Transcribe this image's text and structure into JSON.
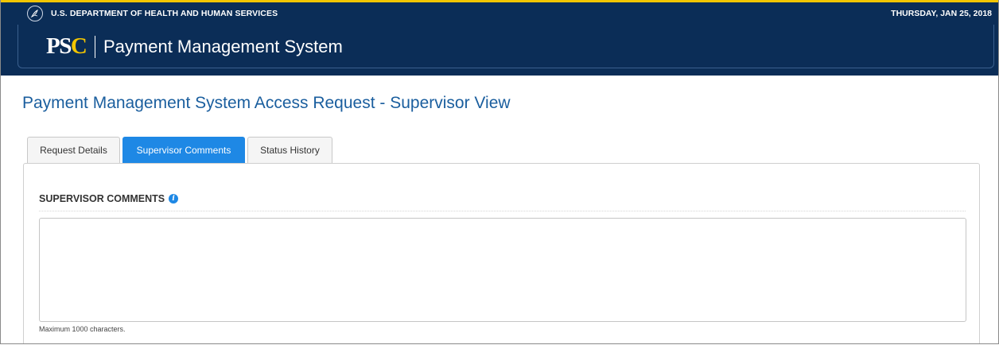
{
  "agency_bar": {
    "department_name": "U.S. DEPARTMENT OF HEALTH AND HUMAN SERVICES",
    "date": "THURSDAY, JAN 25, 2018",
    "icon": "hhs-eagle-icon"
  },
  "app_header": {
    "logo_text_main": "PS",
    "logo_text_accent": "C",
    "app_title": "Payment Management System"
  },
  "page": {
    "title": "Payment Management System Access Request - Supervisor View"
  },
  "tabs": [
    {
      "label": "Request Details",
      "active": false
    },
    {
      "label": "Supervisor Comments",
      "active": true
    },
    {
      "label": "Status History",
      "active": false
    }
  ],
  "supervisor_comments": {
    "heading": "SUPERVISOR COMMENTS",
    "info_icon": "info-icon",
    "value": "",
    "help_text": "Maximum 1000 characters."
  },
  "colors": {
    "header_navy": "#0b2d57",
    "accent_gold": "#f2c500",
    "active_tab_blue": "#1e88e5",
    "title_blue": "#1a5e9e"
  }
}
